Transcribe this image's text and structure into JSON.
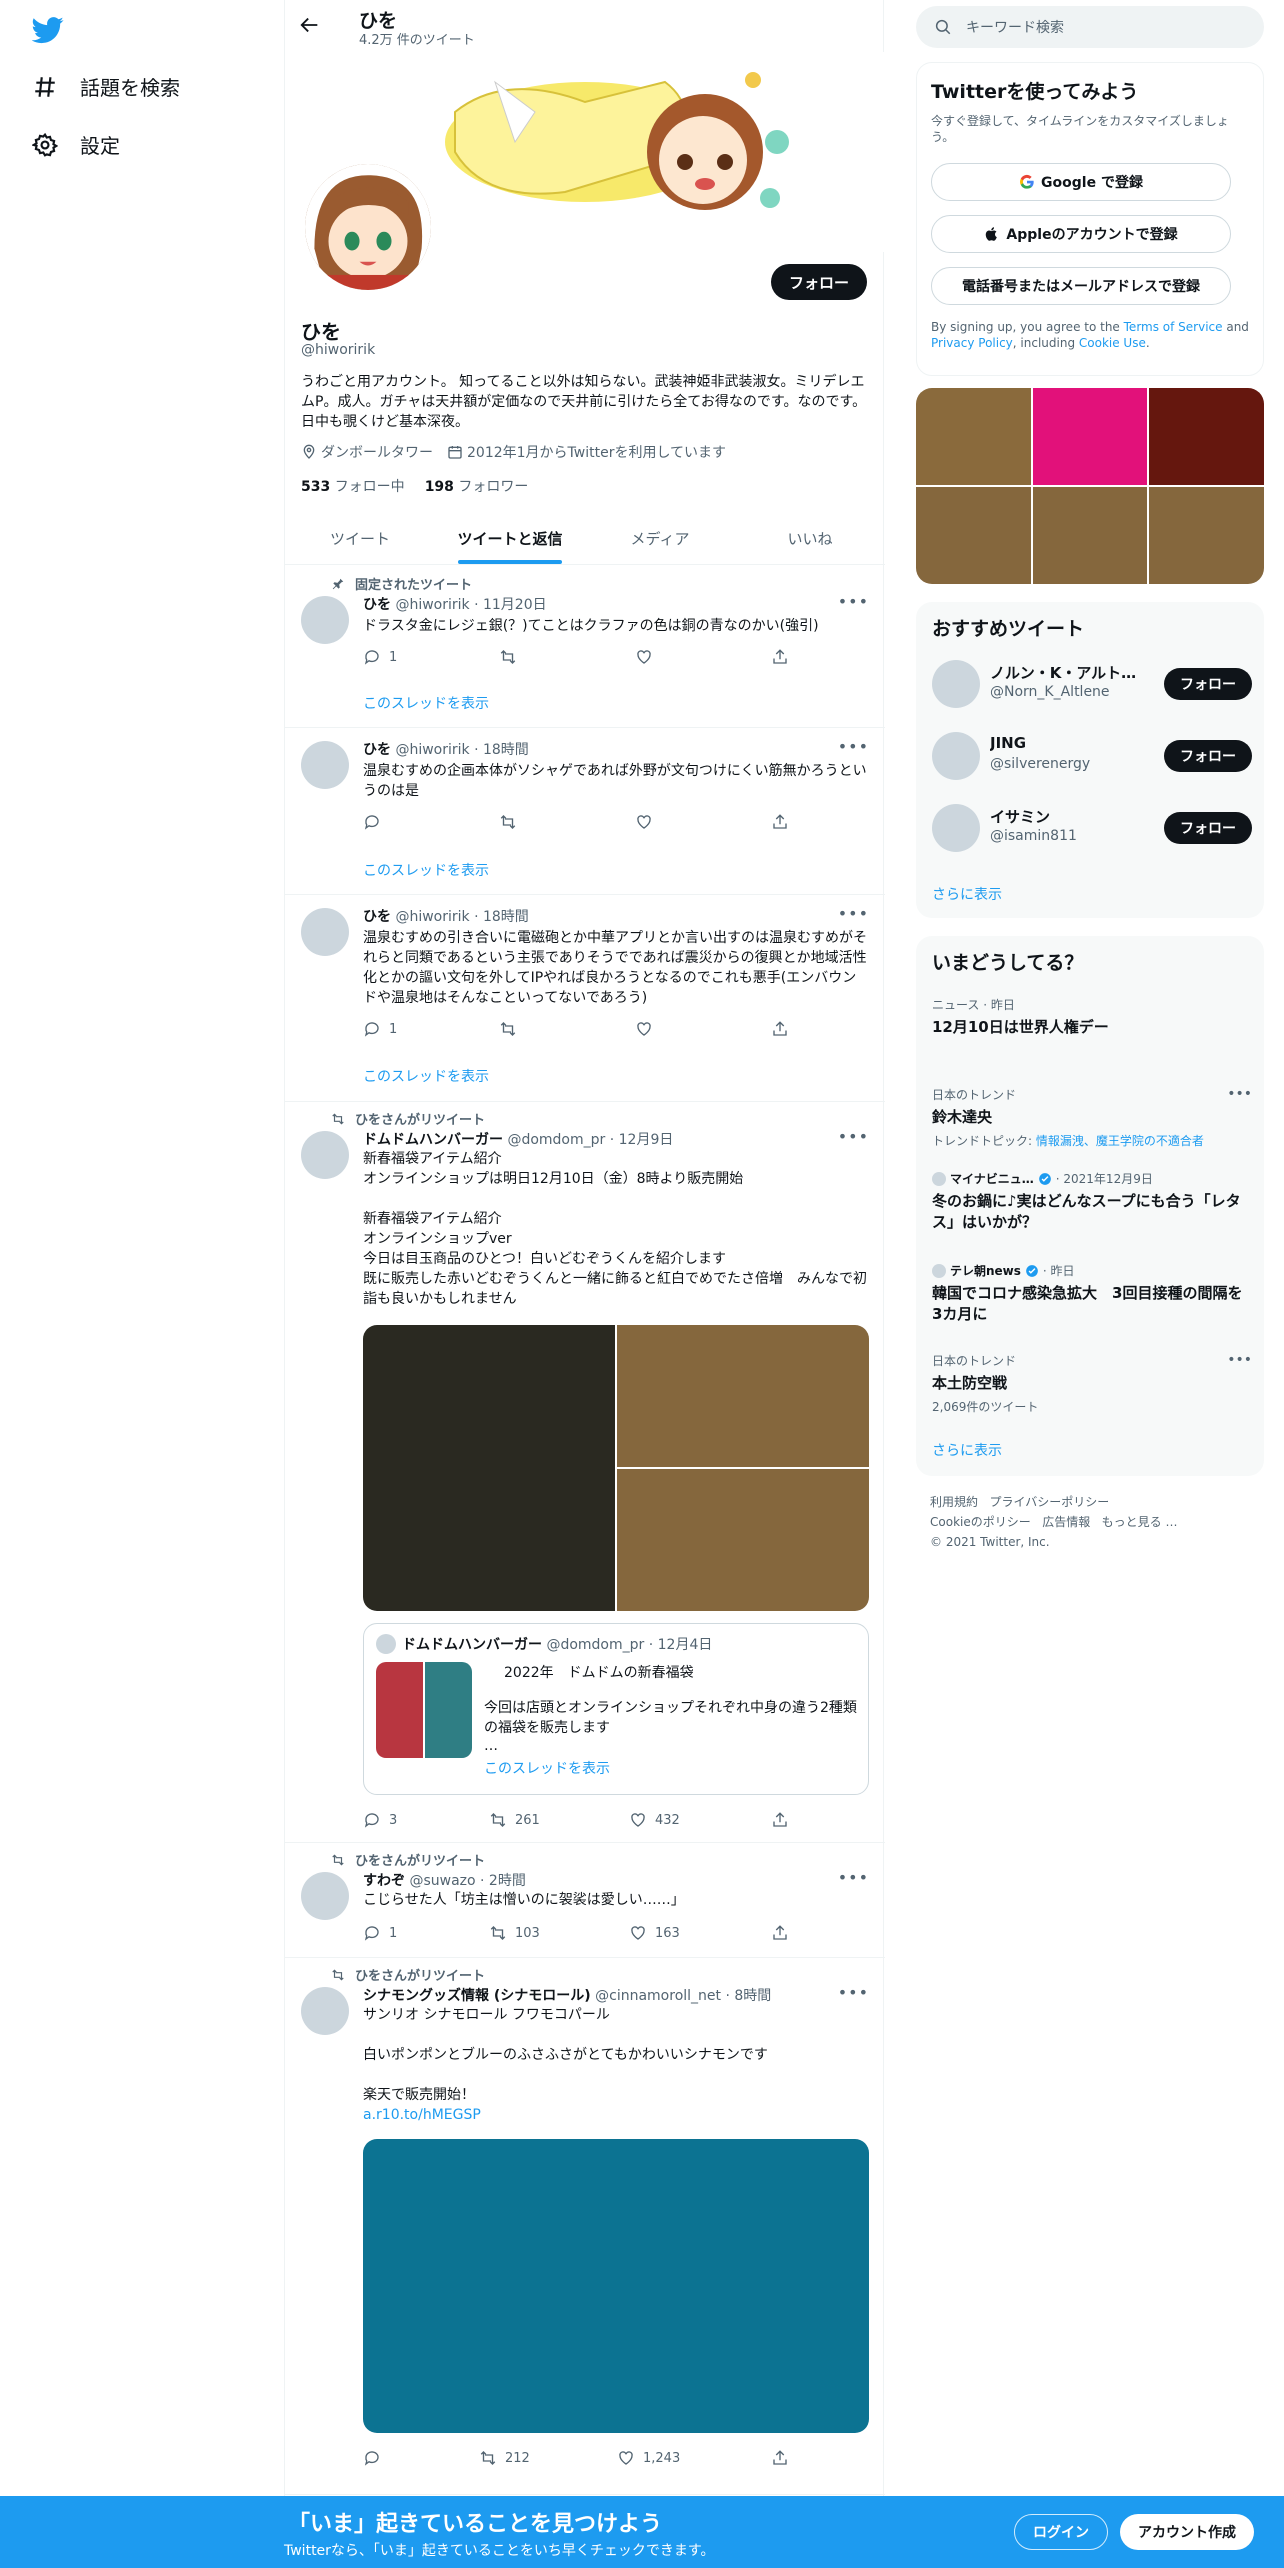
{
  "nav": {
    "explore_label": "話題を検索",
    "settings_label": "設定"
  },
  "header": {
    "name": "ひを",
    "tweet_count": "4.2万 件のツイート"
  },
  "profile": {
    "follow_label": "フォロー",
    "name": "ひを",
    "handle": "@hiworirik",
    "bio": "うわごと用アカウント。 知ってること以外は知らない。武装神姫非武装淑女。ミリデレエムP。成人。ガチャは天井額が定価なので天井前に引けたら全てお得なのです。なのです。日中も覗くけど基本深夜。",
    "location": "ダンボールタワー",
    "joined": "2012年1月からTwitterを利用しています",
    "following_count": "533",
    "following_label": "フォロー中",
    "followers_count": "198",
    "followers_label": "フォロワー"
  },
  "tabs": [
    "ツイート",
    "ツイートと返信",
    "メディア",
    "いいね"
  ],
  "tweets": [
    {
      "context": "固定されたツイート",
      "name": "ひを",
      "meta": "@hiworirik · 11月20日",
      "text": "ドラスタ金にレジェ銀(？)てことはクラファの色は銅の青なのかい(強引)",
      "reply": "1",
      "retweet": "",
      "like": "",
      "thread": "このスレッドを表示"
    },
    {
      "name": "ひを",
      "meta": "@hiworirik · 18時間",
      "text": "温泉むすめの企画本体がソシャゲであれば外野が文句つけにくい筋無かろうというのは是",
      "reply": "",
      "retweet": "",
      "like": "",
      "thread": "このスレッドを表示"
    },
    {
      "name": "ひを",
      "meta": "@hiworirik · 18時間",
      "text": "温泉むすめの引き合いに電磁砲とか中華アプリとか言い出すのは温泉むすめがそれらと同類であるという主張でありそうでであれば震災からの復興とか地域活性化とかの謳い文句を外してIPやれば良かろうとなるのでこれも悪手(エンバウンドや温泉地はそんなこといってないであろう)",
      "reply": "1",
      "retweet": "",
      "like": "",
      "thread": "このスレッドを表示"
    },
    {
      "context": "ひをさんがリツイート",
      "name": "ドムドムハンバーガー",
      "meta": "@domdom_pr · 12月9日",
      "text": "新春福袋アイテム紹介\nオンラインショップは明日12月10日（金）8時より販売開始\n\n新春福袋アイテム紹介\nオンラインショップver\n今日は目玉商品のひとつ！白いどむぞうくんを紹介します\n既に販売した赤いどむぞうくんと一緒に飾ると紅白でめでたさ倍増　みんなで初詣も良いかもしれません",
      "reply": "3",
      "retweet": "261",
      "like": "432",
      "quote": {
        "name": "ドムドムハンバーガー",
        "meta": "@domdom_pr · 12月4日",
        "title": "2022年　ドムドムの新春福袋",
        "text": "今回は店頭とオンラインショップそれぞれ中身の違う2種類の福袋を販売します",
        "ellipsis": "…",
        "thread": "このスレッドを表示"
      }
    },
    {
      "context": "ひをさんがリツイート",
      "name": "すわぞ",
      "meta": "@suwazo · 2時間",
      "text": "こじらせた人「坊主は憎いのに袈裟は愛しい……」",
      "reply": "1",
      "retweet": "103",
      "like": "163"
    },
    {
      "context": "ひをさんがリツイート",
      "name": "シナモングッズ情報 (シナモロール)",
      "meta": "@cinnamoroll_net · 8時間",
      "text": "サンリオ シナモロール フワモコパール\n\n白いポンポンとブルーのふさふさがとてもかわいいシナモンです\n\n楽天で販売開始！",
      "link": "a.r10.to/hMEGSP",
      "reply": "",
      "retweet": "212",
      "like": "1,243"
    }
  ],
  "sidebar": {
    "search_placeholder": "キーワード検索",
    "signup_title": "Twitterを使ってみよう",
    "signup_sub": "今すぐ登録して、タイムラインをカスタマイズしましょう。",
    "google_btn": "Google で登録",
    "apple_btn": "Appleのアカウントで登録",
    "phone_btn": "電話番号またはメールアドレスで登録",
    "terms_1": "By signing up, you agree to the ",
    "terms_tos": "Terms of Service",
    "terms_2": " and ",
    "terms_pp": "Privacy Policy",
    "terms_3": ", including ",
    "terms_cookie": "Cookie Use",
    "terms_4": ".",
    "photo_colors": [
      "#8a6a3c",
      "#e2117a",
      "#65170e",
      "#85673d",
      "#85673d",
      "#85673d"
    ],
    "suggest_title": "おすすめツイート",
    "suggestions": [
      {
        "name": "ノルン・K・アルト…",
        "handle": "@Norn_K_Altlene",
        "btn": "フォロー"
      },
      {
        "name": "JING",
        "handle": "@silverenergy",
        "btn": "フォロー"
      },
      {
        "name": "イサミン",
        "handle": "@isamin811",
        "btn": "フォロー"
      }
    ],
    "show_more": "さらに表示",
    "trends_title": "いまどうしてる？",
    "trends": [
      {
        "meta": "ニュース · 昨日",
        "title": "12月10日は世界人権デー",
        "sub": ""
      },
      {
        "meta": "日本のトレンド",
        "title": "鈴木達央",
        "sub_prefix": "トレンドトピック: ",
        "sub": "情報漏洩、魔王学院の不適合者"
      },
      {
        "meta_source": "マイナビニュ…",
        "meta": " · 2021年12月9日",
        "title": "冬のお鍋に♪実はどんなスープにも合う「レタス」はいかが？",
        "sub": ""
      },
      {
        "meta_source": "テレ朝news",
        "meta": " · 昨日",
        "title": "韓国でコロナ感染急拡大　3回目接種の間隔を3カ月に",
        "sub": ""
      },
      {
        "meta": "日本のトレンド",
        "title": "本土防空戦",
        "sub": "2,069件のツイート"
      }
    ],
    "footer": {
      "terms": "利用規約",
      "privacy": "プライバシーポリシー",
      "cookie": "Cookieのポリシー",
      "ads": "広告情報",
      "more": "もっと見る …",
      "copyright": "© 2021 Twitter, Inc."
    }
  },
  "bottombar": {
    "title": "「いま」起きていることを見つけよう",
    "subtitle": "Twitterなら、「いま」起きていることをいち早くチェックできます。",
    "login": "ログイン",
    "signup": "アカウント作成"
  },
  "colors": {
    "accent": "#1d9bf0",
    "text": "#0f1419",
    "muted": "#536471"
  }
}
